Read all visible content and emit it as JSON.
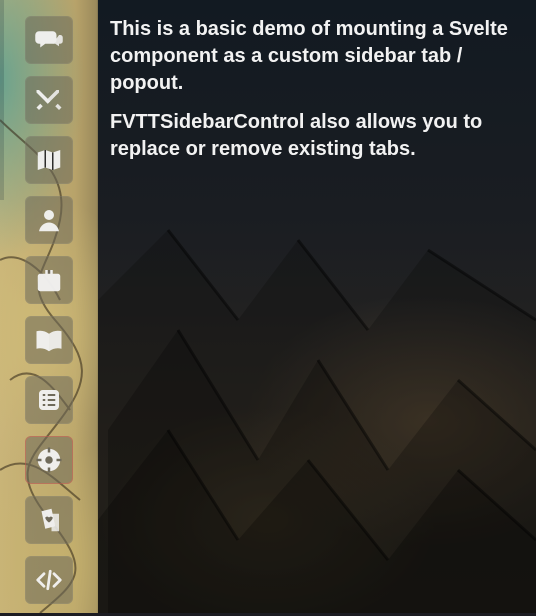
{
  "sidebar": {
    "tabs": [
      {
        "name": "chat-tab",
        "icon": "chat-icon"
      },
      {
        "name": "combat-tab",
        "icon": "crossed-swords-icon"
      },
      {
        "name": "scenes-tab",
        "icon": "map-icon"
      },
      {
        "name": "actors-tab",
        "icon": "user-icon"
      },
      {
        "name": "items-tab",
        "icon": "suitcase-icon"
      },
      {
        "name": "journal-tab",
        "icon": "book-open-icon"
      },
      {
        "name": "tables-tab",
        "icon": "list-icon"
      },
      {
        "name": "playlists-tab",
        "icon": "compass-icon"
      },
      {
        "name": "cards-tab",
        "icon": "cards-icon"
      },
      {
        "name": "code-tab",
        "icon": "code-icon"
      }
    ]
  },
  "main": {
    "paragraphs": [
      "This is a basic demo of mounting a Svelte component as a custom sidebar tab / popout.",
      "FVTTSidebarControl also allows you to replace or remove existing tabs."
    ]
  },
  "colors": {
    "panel_bg": "#1a1d22",
    "text": "#f2f2f2",
    "tab_bg": "#6e695a"
  }
}
